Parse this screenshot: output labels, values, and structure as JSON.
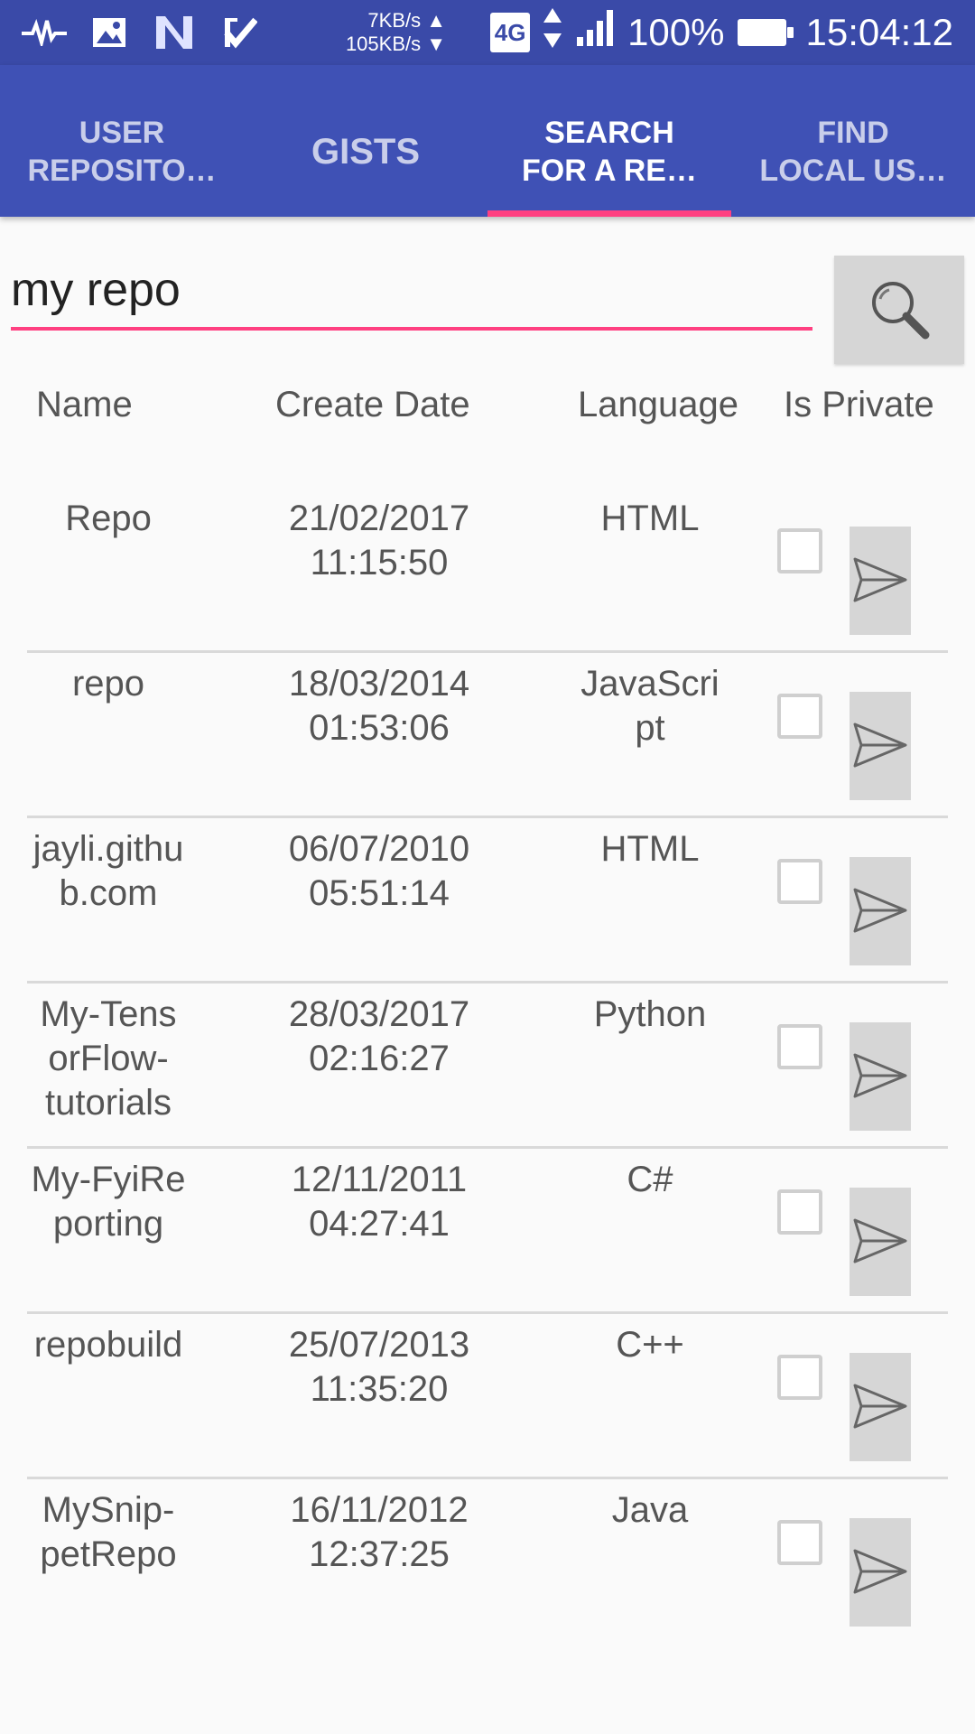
{
  "status_bar": {
    "left_icons": [
      "pulse-icon",
      "image-icon",
      "n-logo-icon",
      "check-task-icon"
    ],
    "upload_speed": "7KB/s ▲",
    "download_speed": "105KB/s ▼",
    "network": "4G",
    "battery": "100%",
    "time": "15:04:12"
  },
  "tabs": [
    {
      "label": "USER\nREPOSITO…",
      "active": false
    },
    {
      "label": "GISTS",
      "active": false
    },
    {
      "label": "SEARCH\nFOR A RE…",
      "active": true
    },
    {
      "label": "FIND\nLOCAL US…",
      "active": false
    }
  ],
  "search": {
    "value": "my repo",
    "button_icon": "search-icon"
  },
  "table": {
    "headers": {
      "name": "Name",
      "date": "Create Date",
      "language": "Language",
      "private": "Is Private"
    },
    "rows": [
      {
        "name": "Repo",
        "date": "21/02/2017\n11:15:50",
        "language": "HTML",
        "is_private": false
      },
      {
        "name": "repo",
        "date": "18/03/2014\n01:53:06",
        "language": "JavaScri\npt",
        "is_private": false
      },
      {
        "name": "jayli.githu\nb.com",
        "date": "06/07/2010\n05:51:14",
        "language": "HTML",
        "is_private": false
      },
      {
        "name": "My-Tens\norFlow-\ntutorials",
        "date": "28/03/2017\n02:16:27",
        "language": "Python",
        "is_private": false
      },
      {
        "name": "My-FyiRe\nporting",
        "date": "12/11/2011\n04:27:41",
        "language": "C#",
        "is_private": false
      },
      {
        "name": "repobuild",
        "date": "25/07/2013\n11:35:20",
        "language": "C++",
        "is_private": false
      },
      {
        "name": "MySnip-\npetRepo",
        "date": "16/11/2012\n12:37:25",
        "language": "Java",
        "is_private": false
      }
    ]
  },
  "colors": {
    "status_bar": "#3a4aa8",
    "toolbar": "#3f51b5",
    "accent": "#ff4081",
    "button": "#d6d6d6"
  }
}
